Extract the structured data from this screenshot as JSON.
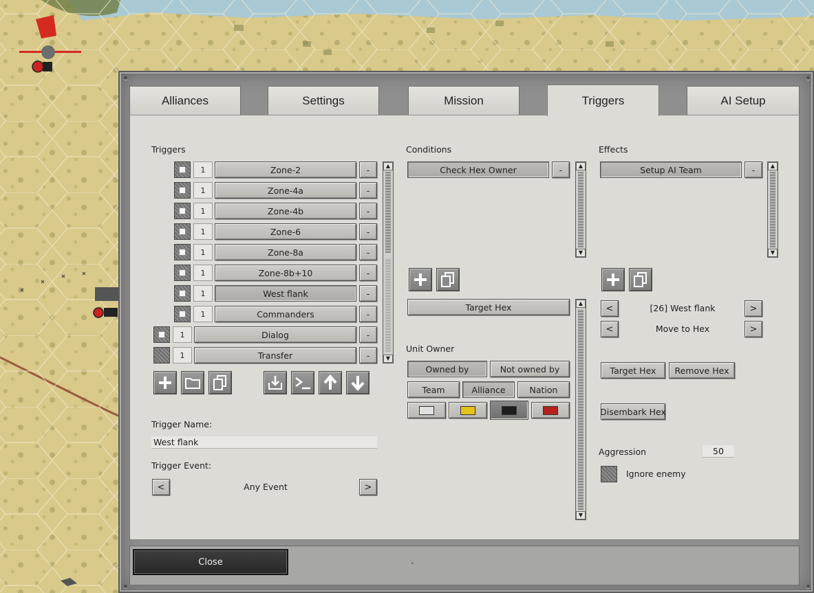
{
  "colors": {
    "map_land": "#d9c98a",
    "map_water": "#a9c9d4",
    "panel_bg": "#dcdbd6",
    "frame": "#8f8f8f",
    "owner_swatches": [
      "#e0e0e0",
      "#e6c21a",
      "#1c1c1c",
      "#b5221d"
    ]
  },
  "tabs": [
    {
      "label": "Alliances"
    },
    {
      "label": "Settings"
    },
    {
      "label": "Mission"
    },
    {
      "label": "Triggers",
      "active": true
    },
    {
      "label": "AI Setup"
    }
  ],
  "triggers": {
    "heading": "Triggers",
    "items": [
      {
        "count": "1",
        "name": "Zone-2"
      },
      {
        "count": "1",
        "name": "Zone-4a"
      },
      {
        "count": "1",
        "name": "Zone-4b"
      },
      {
        "count": "1",
        "name": "Zone-6"
      },
      {
        "count": "1",
        "name": "Zone-8a"
      },
      {
        "count": "1",
        "name": "Zone-8b+10"
      },
      {
        "count": "1",
        "name": "West flank",
        "selected": true
      },
      {
        "count": "1",
        "name": "Commanders"
      },
      {
        "count": "1",
        "name": "Dialog"
      },
      {
        "count": "1",
        "name": "Transfer"
      }
    ],
    "remove_label": "-",
    "toolbar_icons": [
      "add-icon",
      "folder-icon",
      "copy-icon",
      "import-icon",
      "console-icon",
      "move-up-icon",
      "move-down-icon"
    ],
    "name_label": "Trigger Name:",
    "name_value": "West flank",
    "event_label": "Trigger Event:",
    "event_value": "Any Event",
    "prev": "<",
    "next": ">"
  },
  "conditions": {
    "heading": "Conditions",
    "items": [
      {
        "name": "Check Hex Owner"
      }
    ],
    "remove_label": "-",
    "target_hex": "Target Hex",
    "unit_owner_label": "Unit Owner",
    "owned_by": "Owned by",
    "not_owned_by": "Not owned by",
    "team": "Team",
    "alliance": "Alliance",
    "nation": "Nation"
  },
  "effects": {
    "heading": "Effects",
    "items": [
      {
        "name": "Setup AI Team"
      }
    ],
    "remove_label": "-",
    "selector_1": "[26] West flank",
    "selector_2": "Move to Hex",
    "prev": "<",
    "next": ">",
    "target_hex": "Target Hex",
    "remove_hex": "Remove Hex",
    "disembark_hex": "Disembark Hex",
    "aggression_label": "Aggression",
    "aggression_value": "50",
    "ignore_enemy": "Ignore enemy"
  },
  "footer": {
    "close": "Close",
    "separator": "-"
  }
}
